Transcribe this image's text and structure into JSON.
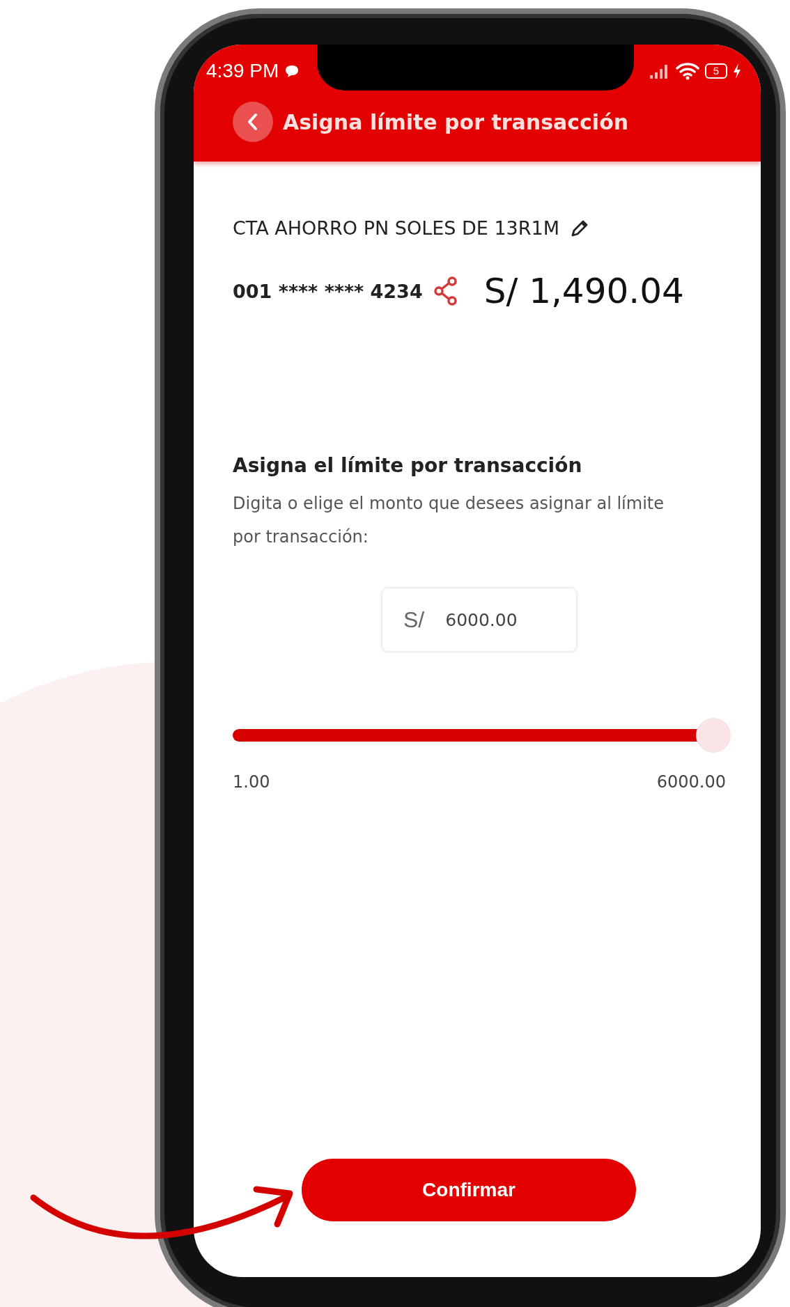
{
  "status_bar": {
    "time": "4:39 PM",
    "battery": "5"
  },
  "header": {
    "title": "Asigna límite por transacción"
  },
  "account": {
    "name": "CTA AHORRO PN SOLES DE 13R1M",
    "number": "001 **** **** 4234",
    "balance": "S/ 1,490.04"
  },
  "limit": {
    "heading": "Asigna el límite por transacción",
    "description": "Digita o elige el monto que desees asignar al límite por transacción:",
    "currency": "S/",
    "amount": "6000.00",
    "slider": {
      "level": 1,
      "min_label": "1.00",
      "max_label": "6000.00"
    }
  },
  "confirm_button": {
    "label": "Confirmar"
  }
}
